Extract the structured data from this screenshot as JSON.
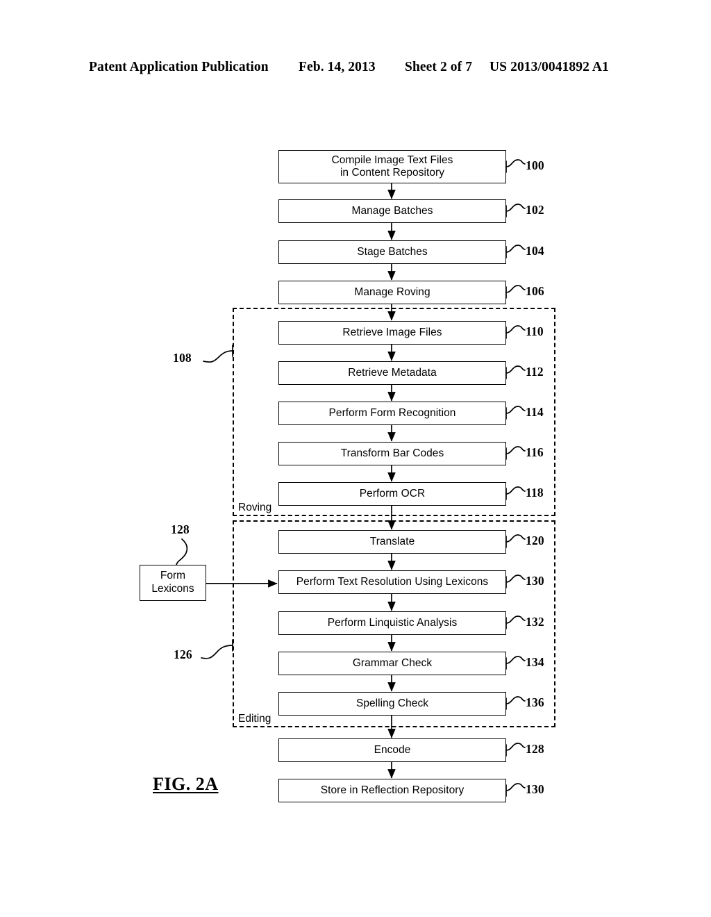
{
  "header": {
    "publication": "Patent Application Publication",
    "date": "Feb. 14, 2013",
    "sheet": "Sheet 2 of 7",
    "number": "US 2013/0041892 A1"
  },
  "figure": {
    "caption": "FIG. 2A"
  },
  "diagram": {
    "type": "flowchart",
    "orientation": "top-to-bottom",
    "steps": [
      {
        "id": "100",
        "label": "Compile Image Text Files\nin Content Repository",
        "line1": "Compile Image Text Files",
        "line2": "in Content Repository",
        "ref": "100",
        "group": null
      },
      {
        "id": "102",
        "label": "Manage Batches",
        "ref": "102",
        "group": null
      },
      {
        "id": "104",
        "label": "Stage Batches",
        "ref": "104",
        "group": null
      },
      {
        "id": "106",
        "label": "Manage Roving",
        "ref": "106",
        "group": null
      },
      {
        "id": "110",
        "label": "Retrieve Image Files",
        "ref": "110",
        "group": "Roving"
      },
      {
        "id": "112",
        "label": "Retrieve Metadata",
        "ref": "112",
        "group": "Roving"
      },
      {
        "id": "114",
        "label": "Perform Form Recognition",
        "ref": "114",
        "group": "Roving"
      },
      {
        "id": "116",
        "label": "Transform Bar Codes",
        "ref": "116",
        "group": "Roving"
      },
      {
        "id": "118",
        "label": "Perform OCR",
        "ref": "118",
        "group": "Roving"
      },
      {
        "id": "120",
        "label": "Translate",
        "ref": "120",
        "group": "Editing"
      },
      {
        "id": "130a",
        "label": "Perform Text Resolution Using Lexicons",
        "ref": "130",
        "group": "Editing"
      },
      {
        "id": "132",
        "label": "Perform Linquistic Analysis",
        "ref": "132",
        "group": "Editing"
      },
      {
        "id": "134",
        "label": "Grammar Check",
        "ref": "134",
        "group": "Editing"
      },
      {
        "id": "136",
        "label": "Spelling Check",
        "ref": "136",
        "group": "Editing"
      },
      {
        "id": "128b",
        "label": "Encode",
        "ref": "128",
        "group": null
      },
      {
        "id": "130b",
        "label": "Store in Reflection Repository",
        "ref": "130",
        "group": null
      }
    ],
    "groups": [
      {
        "id": "108",
        "label": "Roving",
        "ref": "108",
        "ref_side": "left"
      },
      {
        "id": "126",
        "label": "Editing",
        "ref": "126",
        "ref_side": "left"
      }
    ],
    "data_store": {
      "line1": "Form",
      "line2": "Lexicons",
      "ref": "128",
      "feeds_into": "Perform Text Resolution Using Lexicons"
    }
  }
}
